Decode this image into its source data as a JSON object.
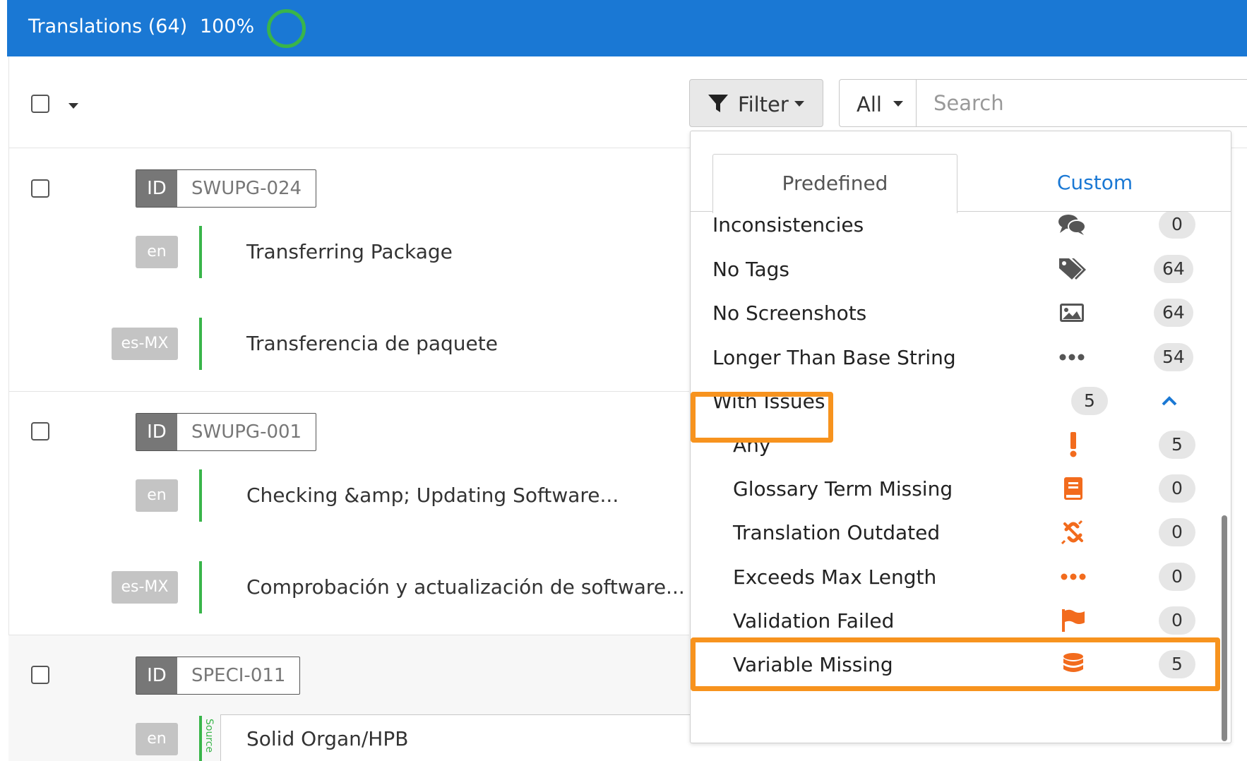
{
  "header": {
    "title": "Translations (64)",
    "progress_label": "100%",
    "progress_value": 1.0,
    "accent_color": "#1a78d4"
  },
  "toolbar": {
    "filter_label": "Filter",
    "scope_label": "All",
    "search_placeholder": "Search"
  },
  "rows": [
    {
      "id_label": "ID",
      "id": "SWUPG-024",
      "source_lang": "en",
      "source_text": "Transferring Package",
      "target_lang": "es-MX",
      "target_text": "Transferencia de paquete"
    },
    {
      "id_label": "ID",
      "id": "SWUPG-001",
      "source_lang": "en",
      "source_text": "Checking &amp; Updating Software...",
      "target_lang": "es-MX",
      "target_text": "Comprobación y actualización de software..."
    },
    {
      "id_label": "ID",
      "id": "SPECI-011",
      "source_lang": "en",
      "source_text": "Solid Organ/HPB",
      "side_label": "Source"
    }
  ],
  "filter_panel": {
    "tabs": {
      "predefined": "Predefined",
      "custom": "Custom"
    },
    "items": [
      {
        "label": "Inconsistencies",
        "icon": "comments-icon",
        "count": "0"
      },
      {
        "label": "No Tags",
        "icon": "tags-icon",
        "count": "64"
      },
      {
        "label": "No Screenshots",
        "icon": "image-icon",
        "count": "64"
      },
      {
        "label": "Longer Than Base String",
        "icon": "ellipsis-icon",
        "count": "54"
      },
      {
        "label": "With Issues",
        "icon": "chevron-up-icon",
        "count": "5"
      }
    ],
    "issue_items": [
      {
        "label": "Any",
        "icon": "exclamation-icon",
        "count": "5"
      },
      {
        "label": "Glossary Term Missing",
        "icon": "book-icon",
        "count": "0"
      },
      {
        "label": "Translation Outdated",
        "icon": "unlink-icon",
        "count": "0"
      },
      {
        "label": "Exceeds Max Length",
        "icon": "ellipsis-icon",
        "count": "0"
      },
      {
        "label": "Validation Failed",
        "icon": "flag-icon",
        "count": "0"
      },
      {
        "label": "Variable Missing",
        "icon": "database-icon",
        "count": "5"
      }
    ],
    "issue_color": "#f26b1d",
    "highlight_color": "#f7931e"
  }
}
